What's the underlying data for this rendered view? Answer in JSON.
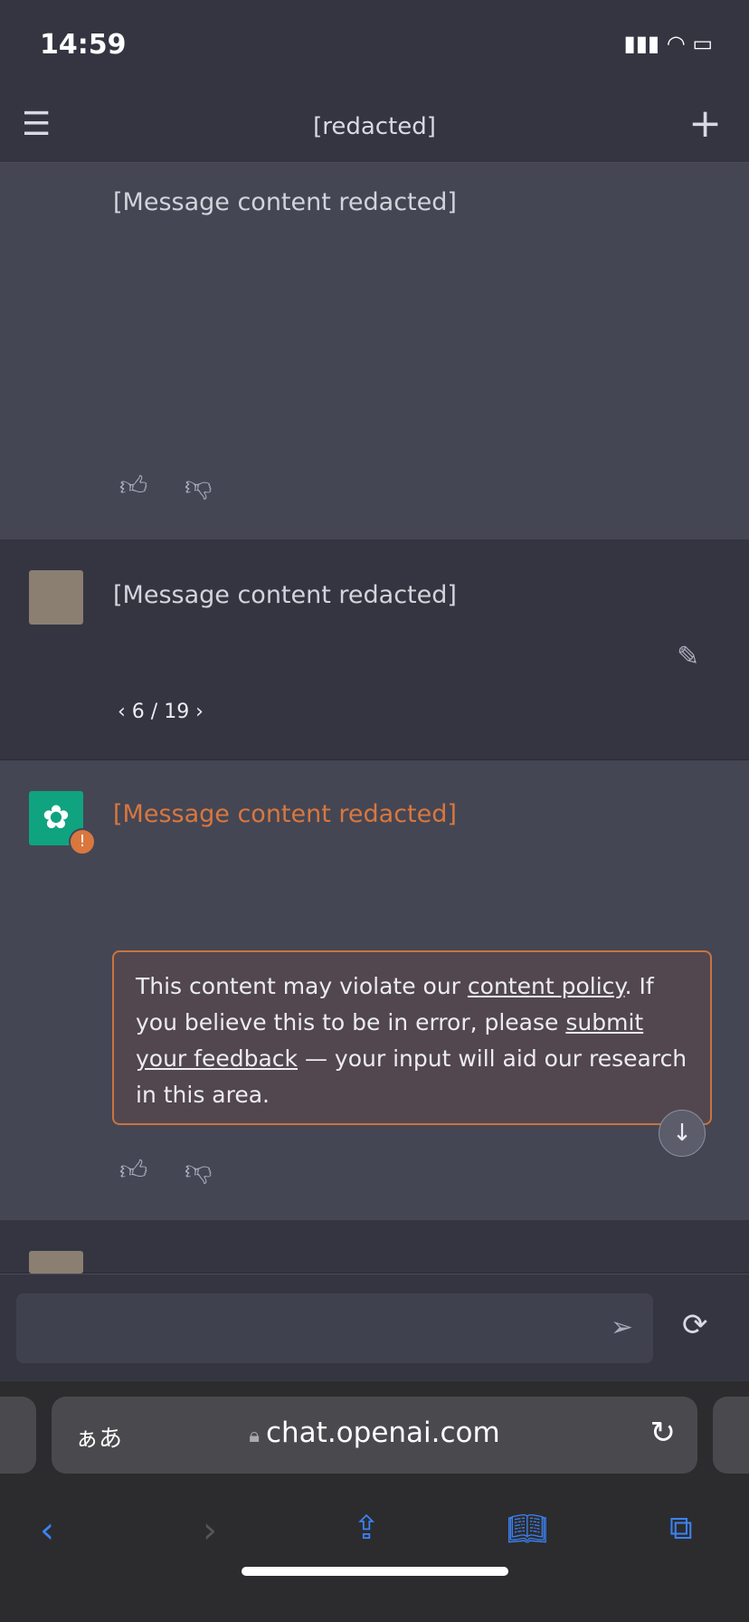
{
  "status": {
    "time": "14:59"
  },
  "header": {
    "title": "[redacted]"
  },
  "messages": [
    {
      "role": "assistant",
      "text": "[Message content redacted]"
    },
    {
      "role": "user",
      "text": "[Message content redacted]",
      "pager": "6 / 19"
    },
    {
      "role": "assistant",
      "text": "[Message content redacted]",
      "flagged": true,
      "policy": {
        "p1": "This content may violate our ",
        "link1": "content policy",
        "p2": ". If you believe this to be in error, please ",
        "link2": "submit your feedback",
        "p3": " — your input will aid our research in this area."
      }
    },
    {
      "role": "user",
      "text": ""
    }
  ],
  "browser": {
    "aa": "ぁあ",
    "url": "chat.openai.com"
  },
  "colors": {
    "accent": "#10a37f",
    "warning": "#d9773e",
    "link": "#3b82f6"
  }
}
